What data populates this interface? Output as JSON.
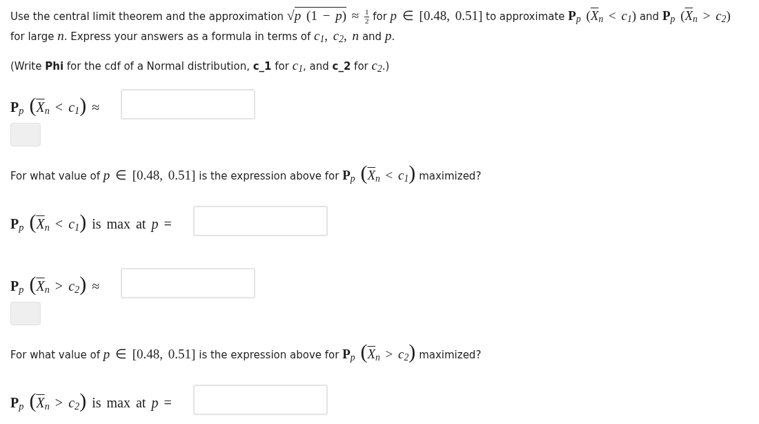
{
  "instructions": {
    "segments": [
      {
        "kind": "text",
        "text": "Use the central limit theorem and the approximation "
      },
      {
        "kind": "sqrt",
        "sign": "√",
        "text": "*p* (1 − *p*)"
      },
      {
        "kind": "math",
        "text": " ≈ "
      },
      {
        "kind": "frac",
        "num": "1",
        "den": "2"
      },
      {
        "kind": "text",
        "text": " for "
      },
      {
        "kind": "math",
        "text": "*p* ∈ [0.48, 0.51]"
      },
      {
        "kind": "text",
        "text": " to approximate "
      },
      {
        "kind": "math",
        "text": "**P**$_{p}$ ("
      },
      {
        "kind": "bar",
        "text": "*X*"
      },
      {
        "kind": "math",
        "text": "$_{n}$ < *c*$_{1}$)"
      },
      {
        "kind": "text",
        "text": " and "
      },
      {
        "kind": "math",
        "text": "**P**$_{p}$ ("
      },
      {
        "kind": "bar",
        "text": "*X*"
      },
      {
        "kind": "math",
        "text": "$_{n}$ > *c*$_{2}$)"
      },
      {
        "kind": "text",
        "text": " for large "
      },
      {
        "kind": "math",
        "text": "*n*"
      },
      {
        "kind": "text",
        "text": ". Express your answers as a formula in terms of "
      },
      {
        "kind": "math",
        "text": "*c*$_{1}$, *c*$_{2}$, *n*"
      },
      {
        "kind": "text",
        "text": " and "
      },
      {
        "kind": "math",
        "text": "*p*"
      },
      {
        "kind": "text",
        "text": "."
      }
    ]
  },
  "note": {
    "segments": [
      {
        "kind": "text",
        "text": "(Write **Phi** for the cdf of a Normal distribution, **c_1** for "
      },
      {
        "kind": "math",
        "text": "*c*$_{1}$"
      },
      {
        "kind": "text",
        "text": ", and **c_2** for "
      },
      {
        "kind": "math",
        "text": "*c*$_{2}$"
      },
      {
        "kind": "text",
        "text": ".)"
      }
    ]
  },
  "items": [
    {
      "kind": "formula",
      "label": [
        {
          "kind": "math",
          "text": "**P**$_{p}$ "
        },
        {
          "kind": "big",
          "text": "("
        },
        {
          "kind": "bar",
          "text": "*X*"
        },
        {
          "kind": "math",
          "text": "$_{n}$ < *c*$_{1}$"
        },
        {
          "kind": "big",
          "text": ")"
        },
        {
          "kind": "math",
          "text": " ≈"
        }
      ]
    },
    {
      "kind": "prompt",
      "segments": [
        {
          "kind": "text",
          "text": "For what value of "
        },
        {
          "kind": "math",
          "text": "*p* ∈ [0.48, 0.51]"
        },
        {
          "kind": "text",
          "text": " is the expression above for "
        },
        {
          "kind": "math",
          "text": "**P**$_{p}$ "
        },
        {
          "kind": "big",
          "text": "("
        },
        {
          "kind": "bar",
          "text": "*X*"
        },
        {
          "kind": "math",
          "text": "$_{n}$ < *c*$_{1}$"
        },
        {
          "kind": "big",
          "text": ")"
        },
        {
          "kind": "text",
          "text": " maximized?"
        }
      ]
    },
    {
      "kind": "value",
      "label": [
        {
          "kind": "math",
          "text": "**P**$_{p}$ "
        },
        {
          "kind": "big",
          "text": "("
        },
        {
          "kind": "bar",
          "text": "*X*"
        },
        {
          "kind": "math",
          "text": "$_{n}$ < *c*$_{1}$"
        },
        {
          "kind": "big",
          "text": ")"
        },
        {
          "kind": "math",
          "text": " is max at *p* ="
        }
      ]
    },
    {
      "kind": "formula",
      "label": [
        {
          "kind": "math",
          "text": "**P**$_{p}$ "
        },
        {
          "kind": "big",
          "text": "("
        },
        {
          "kind": "bar",
          "text": "*X*"
        },
        {
          "kind": "math",
          "text": "$_{n}$ > *c*$_{2}$"
        },
        {
          "kind": "big",
          "text": ")"
        },
        {
          "kind": "math",
          "text": " ≈"
        }
      ]
    },
    {
      "kind": "prompt",
      "segments": [
        {
          "kind": "text",
          "text": "For what value of "
        },
        {
          "kind": "math",
          "text": "*p* ∈ [0.48, 0.51]"
        },
        {
          "kind": "text",
          "text": " is the expression above for "
        },
        {
          "kind": "math",
          "text": "**P**$_{p}$ "
        },
        {
          "kind": "big",
          "text": "("
        },
        {
          "kind": "bar",
          "text": "*X*"
        },
        {
          "kind": "math",
          "text": "$_{n}$ > *c*$_{2}$"
        },
        {
          "kind": "big",
          "text": ")"
        },
        {
          "kind": "text",
          "text": " maximized?"
        }
      ]
    },
    {
      "kind": "value",
      "label": [
        {
          "kind": "math",
          "text": "**P**$_{p}$ "
        },
        {
          "kind": "big",
          "text": "("
        },
        {
          "kind": "bar",
          "text": "*X*"
        },
        {
          "kind": "math",
          "text": "$_{n}$ > *c*$_{2}$"
        },
        {
          "kind": "big",
          "text": ")"
        },
        {
          "kind": "math",
          "text": " is max at *p* ="
        }
      ]
    }
  ]
}
